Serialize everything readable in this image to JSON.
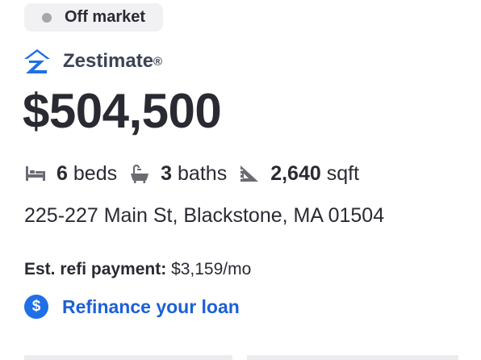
{
  "status": {
    "label": "Off market",
    "dot_color": "#a7a6ab"
  },
  "zestimate": {
    "icon": "zillow-logo-icon",
    "label": "Zestimate",
    "reg_mark": "®",
    "value": "$504,500"
  },
  "facts": {
    "beds": {
      "icon": "bed-icon",
      "value": "6",
      "unit": "beds"
    },
    "baths": {
      "icon": "bathtub-icon",
      "value": "3",
      "unit": "baths"
    },
    "sqft": {
      "icon": "ruler-triangle-icon",
      "value": "2,640",
      "unit": "sqft"
    }
  },
  "address": "225-227 Main St, Blackstone, MA 01504",
  "refi": {
    "label": "Est. refi payment:",
    "value": "$3,159/mo",
    "link_icon": "dollar-circle-icon",
    "link_icon_glyph": "$",
    "link_label": "Refinance your loan",
    "link_color": "#1b60d8"
  }
}
